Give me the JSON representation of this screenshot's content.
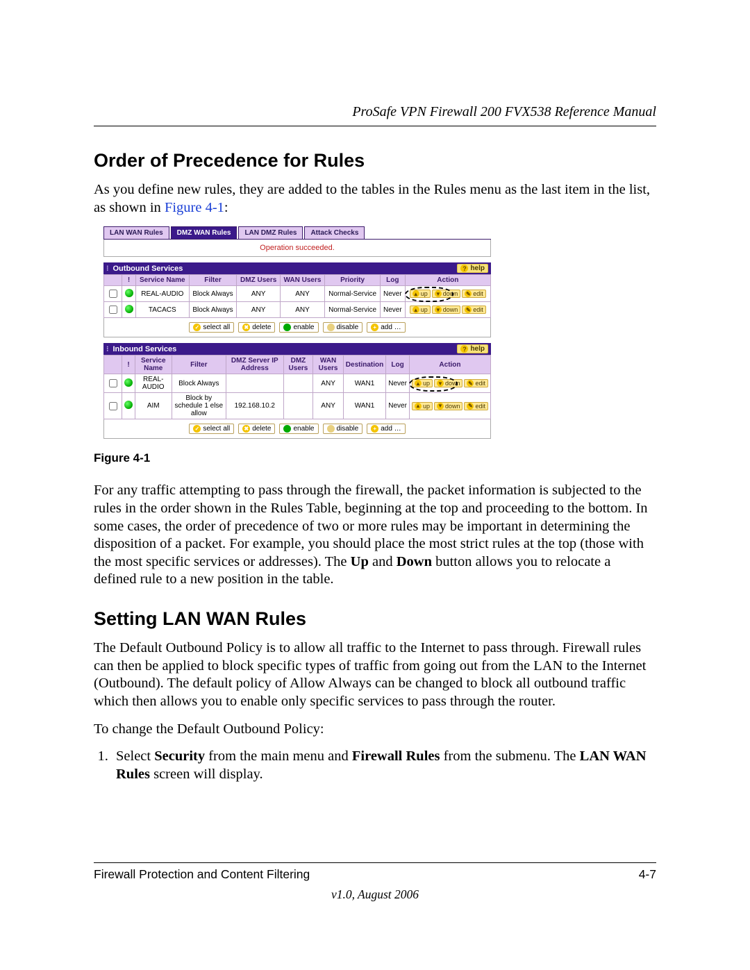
{
  "header": {
    "title": "ProSafe VPN Firewall 200 FVX538 Reference Manual"
  },
  "section1": {
    "title": "Order of Precedence for Rules",
    "para_a": "As you define new rules, they are added to the tables in the Rules menu as the last item in the list, as shown in ",
    "figref": "Figure 4-1",
    "para_b": ":"
  },
  "figure": {
    "tabs": [
      "LAN WAN Rules",
      "DMZ WAN Rules",
      "LAN DMZ Rules",
      "Attack Checks"
    ],
    "active_tab_index": 1,
    "operation_msg": "Operation succeeded.",
    "help_label": "help",
    "action_up": "up",
    "action_down": "down",
    "action_edit": "edit",
    "outbound": {
      "header": "Outbound Services",
      "cols": [
        "!",
        "Service Name",
        "Filter",
        "DMZ Users",
        "WAN Users",
        "Priority",
        "Log",
        "Action"
      ],
      "rows": [
        {
          "name": "REAL-AUDIO",
          "filter": "Block Always",
          "dmz": "ANY",
          "wan": "ANY",
          "prio": "Normal-Service",
          "log": "Never"
        },
        {
          "name": "TACACS",
          "filter": "Block Always",
          "dmz": "ANY",
          "wan": "ANY",
          "prio": "Normal-Service",
          "log": "Never"
        }
      ]
    },
    "inbound": {
      "header": "Inbound Services",
      "cols": [
        "!",
        "Service Name",
        "Filter",
        "DMZ Server IP Address",
        "DMZ Users",
        "WAN Users",
        "Destination",
        "Log",
        "Action"
      ],
      "rows": [
        {
          "name": "REAL-AUDIO",
          "filter": "Block Always",
          "addr": "",
          "dmz": "",
          "wan": "ANY",
          "dest": "WAN1",
          "log": "Never"
        },
        {
          "name": "AIM",
          "filter": "Block by schedule 1 else allow",
          "addr": "192.168.10.2",
          "dmz": "",
          "wan": "ANY",
          "dest": "WAN1",
          "log": "Never"
        }
      ]
    },
    "btns": {
      "selectall": "select all",
      "delete": "delete",
      "enable": "enable",
      "disable": "disable",
      "add": "add …"
    },
    "caption": "Figure 4-1"
  },
  "para2": {
    "a": "For any traffic attempting to pass through the firewall, the packet information is subjected to the rules in the order shown in the Rules Table, beginning at the top and proceeding to the bottom. In some cases, the order of precedence of two or more rules may be important in determining the disposition of a packet. For example, you should place the most strict rules at the top (those with the most specific services or addresses). The ",
    "up": "Up",
    "mid": " and ",
    "down": "Down",
    "b": " button allows you to relocate a defined rule to a new position in the table."
  },
  "section2": {
    "title": "Setting LAN WAN Rules",
    "para": "The Default Outbound Policy is to allow all traffic to the Internet to pass through. Firewall rules can then be applied to block specific types of traffic from going out from the LAN to the Internet (Outbound). The default policy of Allow Always can be changed to block all outbound traffic which then allows you to enable only specific services to pass through the router.",
    "lead": "To change the Default Outbound Policy:",
    "step1_a": "Select ",
    "step1_sec": "Security",
    "step1_b": " from the main menu and ",
    "step1_fw": "Firewall Rules",
    "step1_c": " from the submenu. The ",
    "step1_scr": "LAN WAN Rules",
    "step1_d": " screen will display."
  },
  "footer": {
    "left": "Firewall Protection and Content Filtering",
    "right": "4-7",
    "version": "v1.0, August 2006"
  }
}
